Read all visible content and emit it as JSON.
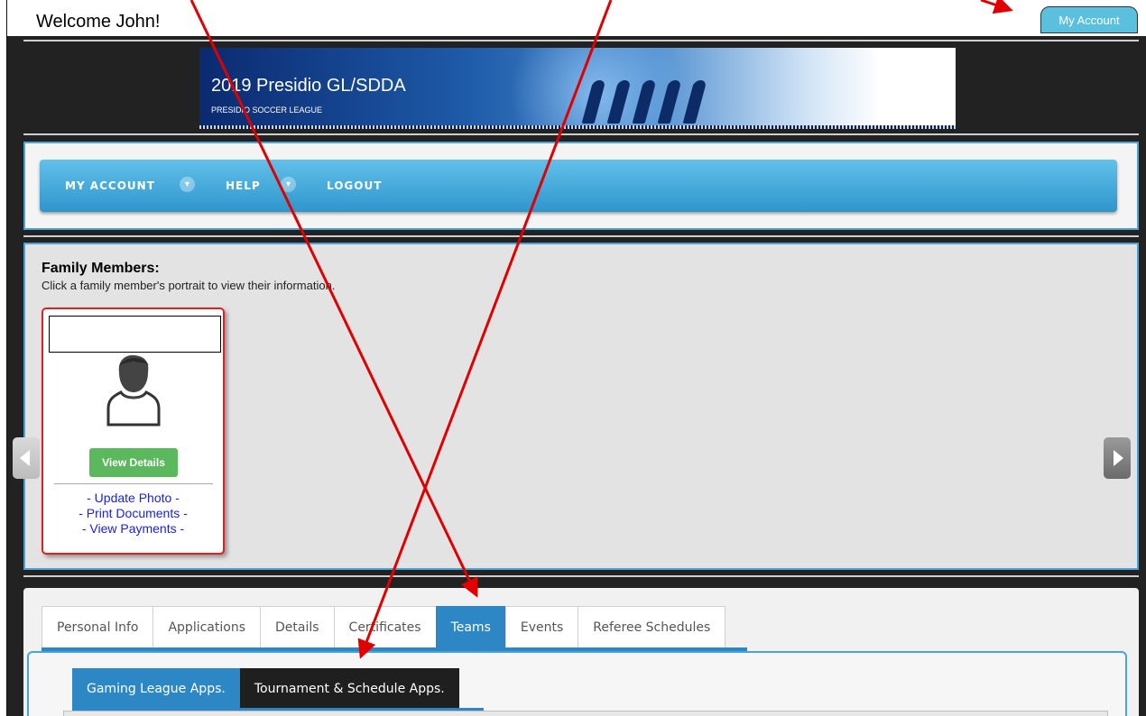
{
  "header": {
    "welcome": "Welcome John!",
    "account_button": "My Account"
  },
  "banner": {
    "title": "2019 Presidio GL/SDDA",
    "subtitle": "PRESIDIO SOCCER LEAGUE"
  },
  "nav": {
    "items": [
      {
        "label": "MY ACCOUNT",
        "has_dropdown": true
      },
      {
        "label": "HELP",
        "has_dropdown": true
      },
      {
        "label": "LOGOUT",
        "has_dropdown": false
      }
    ],
    "dropdown_icon": "chevron-down-icon"
  },
  "family": {
    "title": "Family Members:",
    "subtitle": "Click a family member's portrait to view their information.",
    "card": {
      "name": "",
      "view_button": "View Details",
      "links": [
        "- Update Photo -",
        "- Print Documents -",
        "- View Payments -"
      ]
    },
    "prev_icon": "arrow-left-icon",
    "next_icon": "arrow-right-icon"
  },
  "tabs": {
    "items": [
      "Personal Info",
      "Applications",
      "Details",
      "Certificates",
      "Teams",
      "Events",
      "Referee Schedules"
    ],
    "active": "Teams"
  },
  "subtabs": {
    "items": [
      "Gaming League Apps.",
      "Tournament & Schedule Apps."
    ],
    "active": "Gaming League Apps."
  },
  "colors": {
    "nav_blue": "#2f96cc",
    "tab_active": "#2d87c5",
    "green_button": "#5cb85c",
    "card_border": "#e02020",
    "annotation_arrow": "#e00000"
  }
}
